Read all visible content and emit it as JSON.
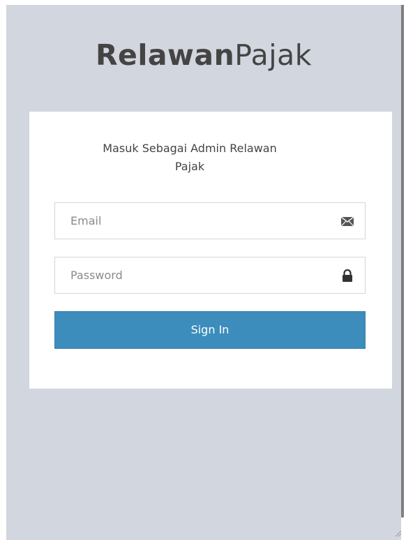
{
  "logo": {
    "bold_text": "Relawan",
    "light_text": "Pajak"
  },
  "login": {
    "message": "Masuk Sebagai Admin Relawan Pajak",
    "email_placeholder": "Email",
    "email_icon": "envelope-icon",
    "password_placeholder": "Password",
    "password_icon": "lock-icon",
    "signin_label": "Sign In"
  },
  "colors": {
    "background": "#d2d6de",
    "box": "#ffffff",
    "primary": "#3c8dbc",
    "text": "#444444"
  }
}
